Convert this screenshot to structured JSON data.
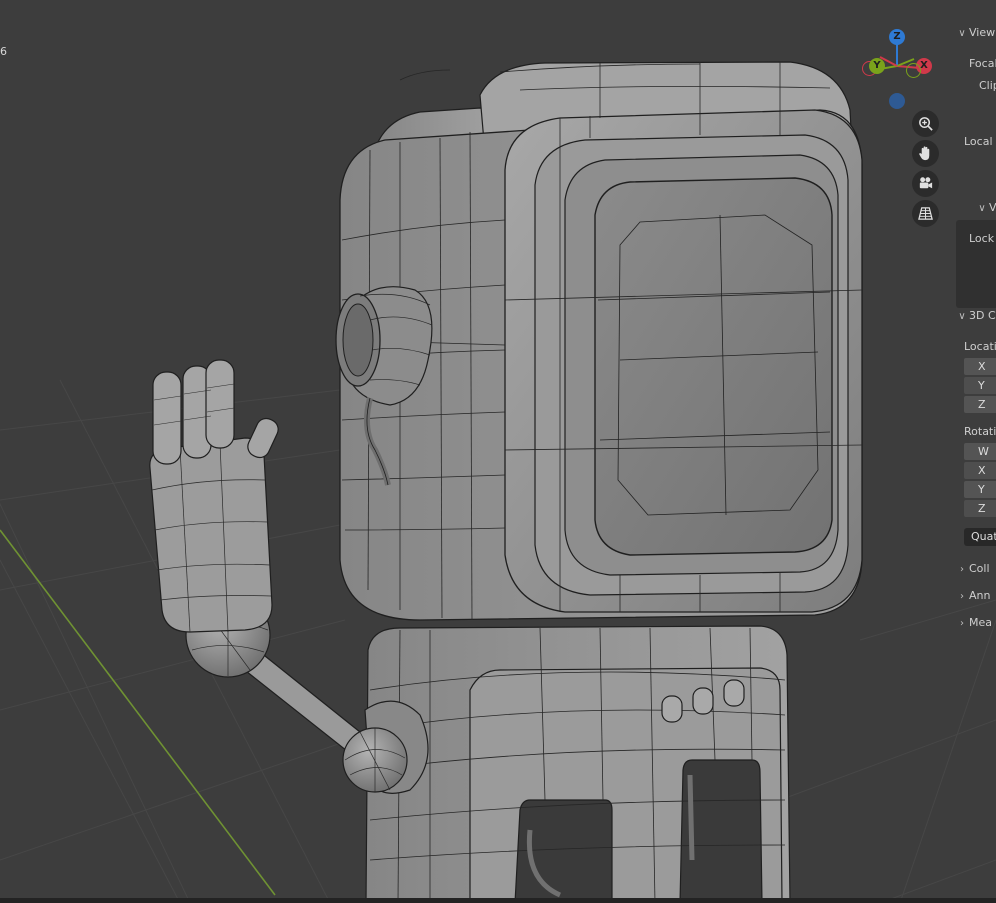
{
  "viewport": {
    "corner_text": "6",
    "background": "#3d3d3d",
    "grid_color": "#4a4a4a",
    "y_axis_color": "#6f9233",
    "model_fill": "#8f8f8f",
    "wire_color": "#1f1f1f"
  },
  "gizmo": {
    "z_label": "Z",
    "y_label": "Y",
    "x_label": "X",
    "colors": {
      "z": "#2e7ad4",
      "y": "#7aa21b",
      "x": "#d0394a"
    }
  },
  "nav_buttons": [
    {
      "name": "zoom-icon"
    },
    {
      "name": "hand-pan-icon"
    },
    {
      "name": "camera-icon"
    },
    {
      "name": "perspective-grid-icon"
    }
  ],
  "npanel": {
    "view_header": "View",
    "focal_label": "Focal",
    "clip_label": "Clip",
    "local_label": "Local c",
    "sub_header": "V",
    "lock_label": "Lock",
    "cursor_header": "3D C",
    "location_label": "Locati",
    "location_fields": [
      "X",
      "Y",
      "Z"
    ],
    "rotation_label": "Rotatio",
    "rotation_fields": [
      "W",
      "X",
      "Y",
      "Z"
    ],
    "rotation_mode": "Quate",
    "collapsed_sections": [
      "Coll",
      "Ann",
      "Mea"
    ]
  }
}
